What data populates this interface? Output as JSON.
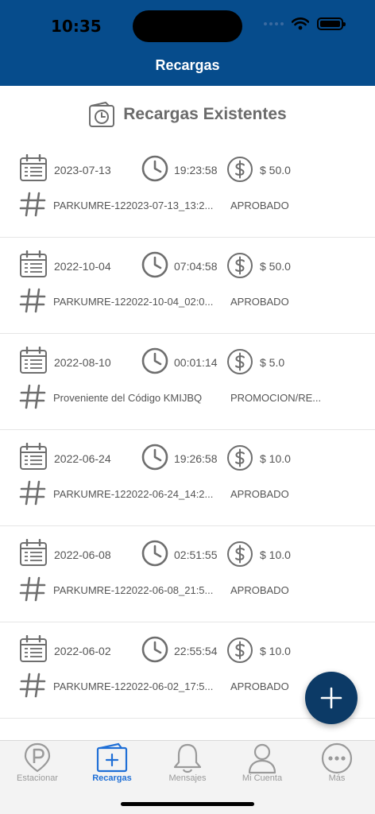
{
  "status_bar": {
    "time": "10:35"
  },
  "header": {
    "title": "Recargas"
  },
  "section": {
    "title": "Recargas Existentes"
  },
  "records": [
    {
      "date": "2023-07-13",
      "time": "19:23:58",
      "amount": "$ 50.0",
      "reference": "PARKUMRE-122023-07-13_13:2...",
      "status": "APROBADO"
    },
    {
      "date": "2022-10-04",
      "time": "07:04:58",
      "amount": "$ 50.0",
      "reference": "PARKUMRE-122022-10-04_02:0...",
      "status": "APROBADO"
    },
    {
      "date": "2022-08-10",
      "time": "00:01:14",
      "amount": "$ 5.0",
      "reference": "Proveniente del Código KMIJBQ",
      "status": "PROMOCION/RE..."
    },
    {
      "date": "2022-06-24",
      "time": "19:26:58",
      "amount": "$ 10.0",
      "reference": "PARKUMRE-122022-06-24_14:2...",
      "status": "APROBADO"
    },
    {
      "date": "2022-06-08",
      "time": "02:51:55",
      "amount": "$ 10.0",
      "reference": "PARKUMRE-122022-06-08_21:5...",
      "status": "APROBADO"
    },
    {
      "date": "2022-06-02",
      "time": "22:55:54",
      "amount": "$ 10.0",
      "reference": "PARKUMRE-122022-06-02_17:5...",
      "status": "APROBADO"
    }
  ],
  "tabbar": {
    "tabs": [
      {
        "label": "Estacionar",
        "icon": "parking-icon"
      },
      {
        "label": "Recargas",
        "icon": "recharge-icon"
      },
      {
        "label": "Mensajes",
        "icon": "bell-icon"
      },
      {
        "label": "Mi Cuenta",
        "icon": "user-icon"
      },
      {
        "label": "Más",
        "icon": "more-icon"
      }
    ],
    "active_index": 1
  },
  "colors": {
    "header": "#064c8c",
    "accent": "#1f6fd6",
    "fab": "#0c3a66",
    "icon": "#6e6e6e"
  }
}
